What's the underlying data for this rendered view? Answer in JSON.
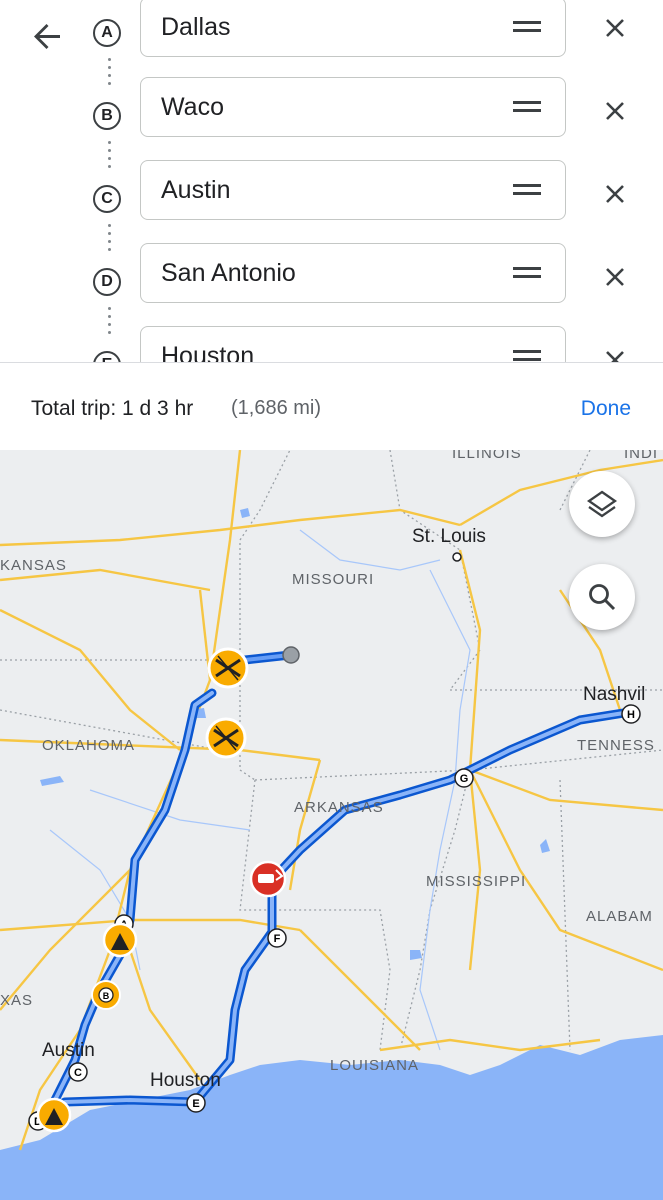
{
  "stops": [
    {
      "letter": "A",
      "place": "Dallas"
    },
    {
      "letter": "B",
      "place": "Waco"
    },
    {
      "letter": "C",
      "place": "Austin"
    },
    {
      "letter": "D",
      "place": "San Antonio"
    },
    {
      "letter": "E",
      "place": "Houston"
    }
  ],
  "trip": {
    "label": "Total trip: 1 d 3 hr",
    "distance": "(1,686 mi)",
    "done": "Done"
  },
  "map": {
    "labels": {
      "illinois": "ILLINOIS",
      "indiana": "INDI",
      "st_louis": "St. Louis",
      "kansas": "KANSAS",
      "missouri": "MISSOURI",
      "oklahoma": "OKLAHOMA",
      "nashville": "Nashvil",
      "tennessee": "TENNESS",
      "arkansas": "ARKANSAS",
      "mississippi": "MISSISSIPPI",
      "alabama": "ALABAM",
      "texas": "XAS",
      "austin": "Austin",
      "houston": "Houston",
      "louisiana": "LOUISIANA"
    },
    "route_markers": [
      "A",
      "B",
      "C",
      "D",
      "E",
      "F",
      "G",
      "H"
    ],
    "colors": {
      "route": "#1a73e8",
      "route_outline": "#0b57d0",
      "highway": "#f6c644",
      "water": "#8ab4f8",
      "incident": "#f9ab00",
      "crash": "#d93025"
    }
  },
  "buttons": {
    "layers": "layers-icon",
    "search": "search-icon"
  }
}
